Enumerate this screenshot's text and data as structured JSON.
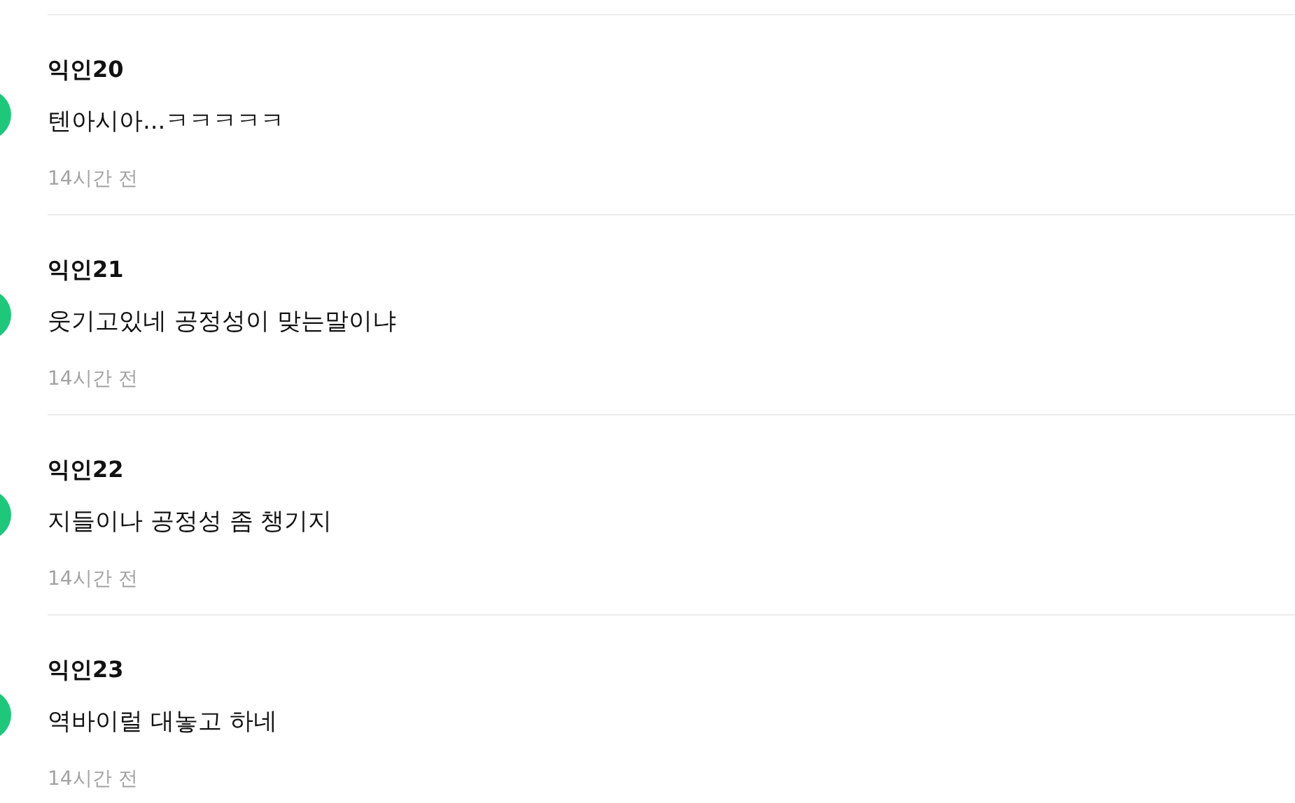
{
  "comments": [
    {
      "author": "익인20",
      "text": "텐아시아...ㅋㅋㅋㅋㅋ",
      "time": "14시간 전"
    },
    {
      "author": "익인21",
      "text": "웃기고있네 공정성이 맞는말이냐",
      "time": "14시간 전"
    },
    {
      "author": "익인22",
      "text": "지들이나 공정성 좀 챙기지",
      "time": "14시간 전"
    },
    {
      "author": "익인23",
      "text": "역바이럴 대놓고 하네",
      "time": "14시간 전"
    }
  ]
}
